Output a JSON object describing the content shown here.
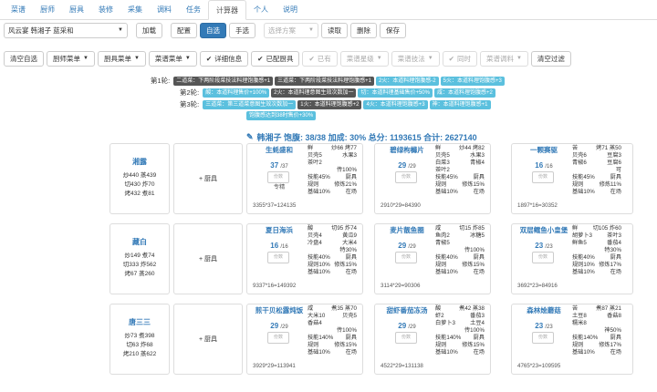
{
  "tabs": [
    "菜谱",
    "厨师",
    "厨具",
    "装修",
    "采集",
    "调料",
    "任务",
    "计算器",
    "个人",
    "说明"
  ],
  "active_tab": 7,
  "row1": {
    "rule_select": "风云宴 韩湘子 蓝采和",
    "load": "加载",
    "config": "配置",
    "auto": "自选",
    "manual": "手选",
    "plan_placeholder": "选择方案",
    "read": "读取",
    "delete": "删除",
    "save": "保存"
  },
  "row2": {
    "clear_auto": "清空自选",
    "chef_menu": "厨师菜单",
    "equip_menu": "厨具菜单",
    "recipe_menu": "菜谱菜单",
    "detail": "详细信息",
    "equipped": "已配厨具",
    "have": "已有",
    "recipe_source": "菜谱星级",
    "recipe_skill": "菜谱技法",
    "same_time": "同时",
    "condiment": "菜谱调料",
    "clear_filter": "清空过滤"
  },
  "rounds": [
    {
      "label": "第1轮:",
      "badges": [
        {
          "t": "二道菜：下两阶段菜技法料理饱腹感+1",
          "c": "dark"
        },
        {
          "t": "三道菜：下两阶段菜技法料理饱腹感+1",
          "c": "dark"
        },
        {
          "t": "2火：本道料理饱腹感-2",
          "c": "blue"
        },
        {
          "t": "5火：本道料理饱腹感+3",
          "c": "blue"
        }
      ]
    },
    {
      "label": "第2轮:",
      "badges": [
        {
          "t": "酸：本道料理售价+100%",
          "c": "blue"
        },
        {
          "t": "2火：本道料理意图生效次数加一",
          "c": "dark"
        },
        {
          "t": "切：本道料理基础售价+50%",
          "c": "blue"
        },
        {
          "t": "咸：本道料理饱腹感+2",
          "c": "blue"
        }
      ]
    },
    {
      "label": "第3轮:",
      "badges": [
        {
          "t": "三道菜：第三道菜意图生效次数加一",
          "c": "blue"
        },
        {
          "t": "1火：本道料理饱腹感+2",
          "c": "dark"
        },
        {
          "t": "4火：本道料理饱腹感+3",
          "c": "blue"
        },
        {
          "t": "神：本道料理饱腹感+1",
          "c": "blue"
        }
      ]
    },
    {
      "label": "",
      "badges": [
        {
          "t": "饱腹感达到38时售价+30%",
          "c": "blue"
        }
      ]
    }
  ],
  "summary": "韩湘子 饱腹: 38/38 加成: 30% 总分: 1193615 合计: 2627140",
  "equip_label": "+ 厨具",
  "chefs": [
    {
      "name": "湘露",
      "stats": [
        "炒440 蒸439",
        "切430 炸70",
        "烤432 煮81"
      ]
    },
    {
      "name": "藏白",
      "stats": [
        "炒149 煮74",
        "切333 炸562",
        "烤67 蒸260"
      ]
    },
    {
      "name": "唐三三",
      "stats": [
        "炒73 煮398",
        "切63 炸68",
        "烤210 蒸622"
      ]
    }
  ],
  "recipes": [
    [
      {
        "name": "生蚝盛和",
        "qty": "37",
        "max": "/37",
        "extra": "专精",
        "calc": "3355*37=124135",
        "rows": [
          [
            "鲜",
            "炒66 烤77"
          ],
          [
            "贝壳5",
            "水果3"
          ],
          [
            "茶叶2",
            ""
          ],
          [
            "",
            "传100%"
          ],
          [
            "技能45%",
            "厨具"
          ],
          [
            "规则",
            "修炼21%"
          ],
          [
            "基础10%",
            "在场"
          ]
        ]
      },
      {
        "name": "碧绿枸櫞片",
        "qty": "29",
        "max": "/29",
        "extra": "",
        "calc": "2910*29=84390",
        "rows": [
          [
            "鲜",
            "炒44 烤82"
          ],
          [
            "贝壳5",
            "水果3"
          ],
          [
            "白菜3",
            "青椒4"
          ],
          [
            "茶叶2",
            ""
          ],
          [
            "技能45%",
            "厨具"
          ],
          [
            "规则",
            "修炼15%"
          ],
          [
            "基础10%",
            "在场"
          ]
        ]
      },
      {
        "name": "一颗赛驱",
        "qty": "16",
        "max": "/16",
        "extra": "",
        "calc": "1897*16=30352",
        "rows": [
          [
            "苦",
            "烤71 蒸50"
          ],
          [
            "贝壳6",
            "豆腐3"
          ],
          [
            "青椒6",
            "豆腐6"
          ],
          [
            "",
            "可"
          ],
          [
            "技能45%",
            "厨具"
          ],
          [
            "规则",
            "修炼11%"
          ],
          [
            "基础10%",
            "在场"
          ]
        ]
      }
    ],
    [
      {
        "name": "夏日海浜",
        "qty": "16",
        "max": "/16",
        "extra": "",
        "calc": "9337*16=149392",
        "rows": [
          [
            "酸",
            "切95 炸74"
          ],
          [
            "贝壳4",
            "黄瓜9"
          ],
          [
            "冷盘4",
            "大米4"
          ],
          [
            "",
            "特30%"
          ],
          [
            "技能40%",
            "厨具"
          ],
          [
            "规则10%",
            "修炼15%"
          ],
          [
            "基础10%",
            "在场"
          ]
        ]
      },
      {
        "name": "麦片靓鱼圈",
        "qty": "29",
        "max": "/29",
        "extra": "",
        "calc": "3114*29=90306",
        "rows": [
          [
            "咸",
            "切15 炸85"
          ],
          [
            "鱼肉2",
            "冰糖5"
          ],
          [
            "青椒5",
            ""
          ],
          [
            "",
            "传100%"
          ],
          [
            "技能40%",
            "厨具"
          ],
          [
            "规则",
            "修炼15%"
          ],
          [
            "基础10%",
            "在场"
          ]
        ]
      },
      {
        "name": "双层鳕鱼小皇堡",
        "qty": "23",
        "max": "/23",
        "extra": "",
        "calc": "3692*23=84916",
        "rows": [
          [
            "鲜",
            "切105 炸60"
          ],
          [
            "胡萝卜3",
            "茶叶3"
          ],
          [
            "鲜鱼5",
            "番茄4"
          ],
          [
            "",
            "特30%"
          ],
          [
            "技能40%",
            "厨具"
          ],
          [
            "规则10%",
            "修炼17%"
          ],
          [
            "基础10%",
            "在场"
          ]
        ]
      }
    ],
    [
      {
        "name": "煎干贝松露炖饭",
        "qty": "29",
        "max": "/29",
        "extra": "",
        "calc": "3929*29=113941",
        "rows": [
          [
            "咸",
            "煮35 蒸70"
          ],
          [
            "大米10",
            "贝壳5"
          ],
          [
            "香菇4",
            ""
          ],
          [
            "",
            "传100%"
          ],
          [
            "技能140%",
            "厨具"
          ],
          [
            "规则",
            "修炼15%"
          ],
          [
            "基础10%",
            "在场"
          ]
        ]
      },
      {
        "name": "甜虾番茄冻汤",
        "qty": "29",
        "max": "/29",
        "extra": "",
        "calc": "4522*29=131138",
        "rows": [
          [
            "酸",
            "煮42 蒸38"
          ],
          [
            "虾2",
            "番茄3"
          ],
          [
            "白萝卜3",
            "土豆4"
          ],
          [
            "",
            "传100%"
          ],
          [
            "技能140%",
            "厨具"
          ],
          [
            "规则",
            "修炼15%"
          ],
          [
            "基础10%",
            "在场"
          ]
        ]
      },
      {
        "name": "森林烩蘑菇",
        "qty": "23",
        "max": "/23",
        "extra": "",
        "calc": "4765*23=109595",
        "rows": [
          [
            "苦",
            "煮87 蒸21"
          ],
          [
            "土豆8",
            "香菇8"
          ],
          [
            "糯米8",
            ""
          ],
          [
            "",
            "神50%"
          ],
          [
            "技能140%",
            "厨具"
          ],
          [
            "规则",
            "修炼17%"
          ],
          [
            "基础10%",
            "在场"
          ]
        ]
      }
    ]
  ],
  "stepper_label": "份数"
}
